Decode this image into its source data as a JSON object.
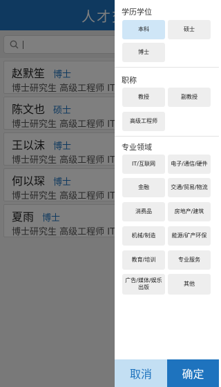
{
  "app": {
    "title": "人才交",
    "search": {
      "placeholder": ""
    },
    "cards": [
      {
        "name": "赵默笙",
        "degree": "博士",
        "detail": "博士研究生  高级工程师  IT/互联"
      },
      {
        "name": "陈文也",
        "degree": "硕士",
        "detail": "博士研究生  高级工程师  IT/互联"
      },
      {
        "name": "王以沫",
        "degree": "博士",
        "detail": "博士研究生  高级工程师  IT/互联"
      },
      {
        "name": "何以琛",
        "degree": "博士",
        "detail": "博士研究生  高级工程师  IT/互联"
      },
      {
        "name": "夏雨",
        "degree": "博士",
        "detail": "博士研究生  高级工程师  IT/互联"
      }
    ]
  },
  "filter": {
    "education": {
      "title": "学历学位",
      "options": [
        "本科",
        "硕士",
        "博士"
      ],
      "selected": "本科"
    },
    "title_rank": {
      "title": "职称",
      "options": [
        "教授",
        "副教授",
        "高级工程师"
      ]
    },
    "field": {
      "title": "专业领域",
      "options": [
        "IT/互联网",
        "电子/通信/硬件",
        "金融",
        "交通/贸易/物流",
        "消费品",
        "房地产/建筑",
        "机械/制造",
        "能源/矿产环保",
        "教育/培训",
        "专业服务",
        "广告/媒体/娱乐出版",
        "其他"
      ]
    },
    "cancel_label": "取消",
    "confirm_label": "确定"
  },
  "colors": {
    "primary": "#1e73be",
    "selected_option_bg": "#cfe6f7",
    "cancel_bg": "#c3dff3",
    "option_bg": "#eeeeee"
  }
}
